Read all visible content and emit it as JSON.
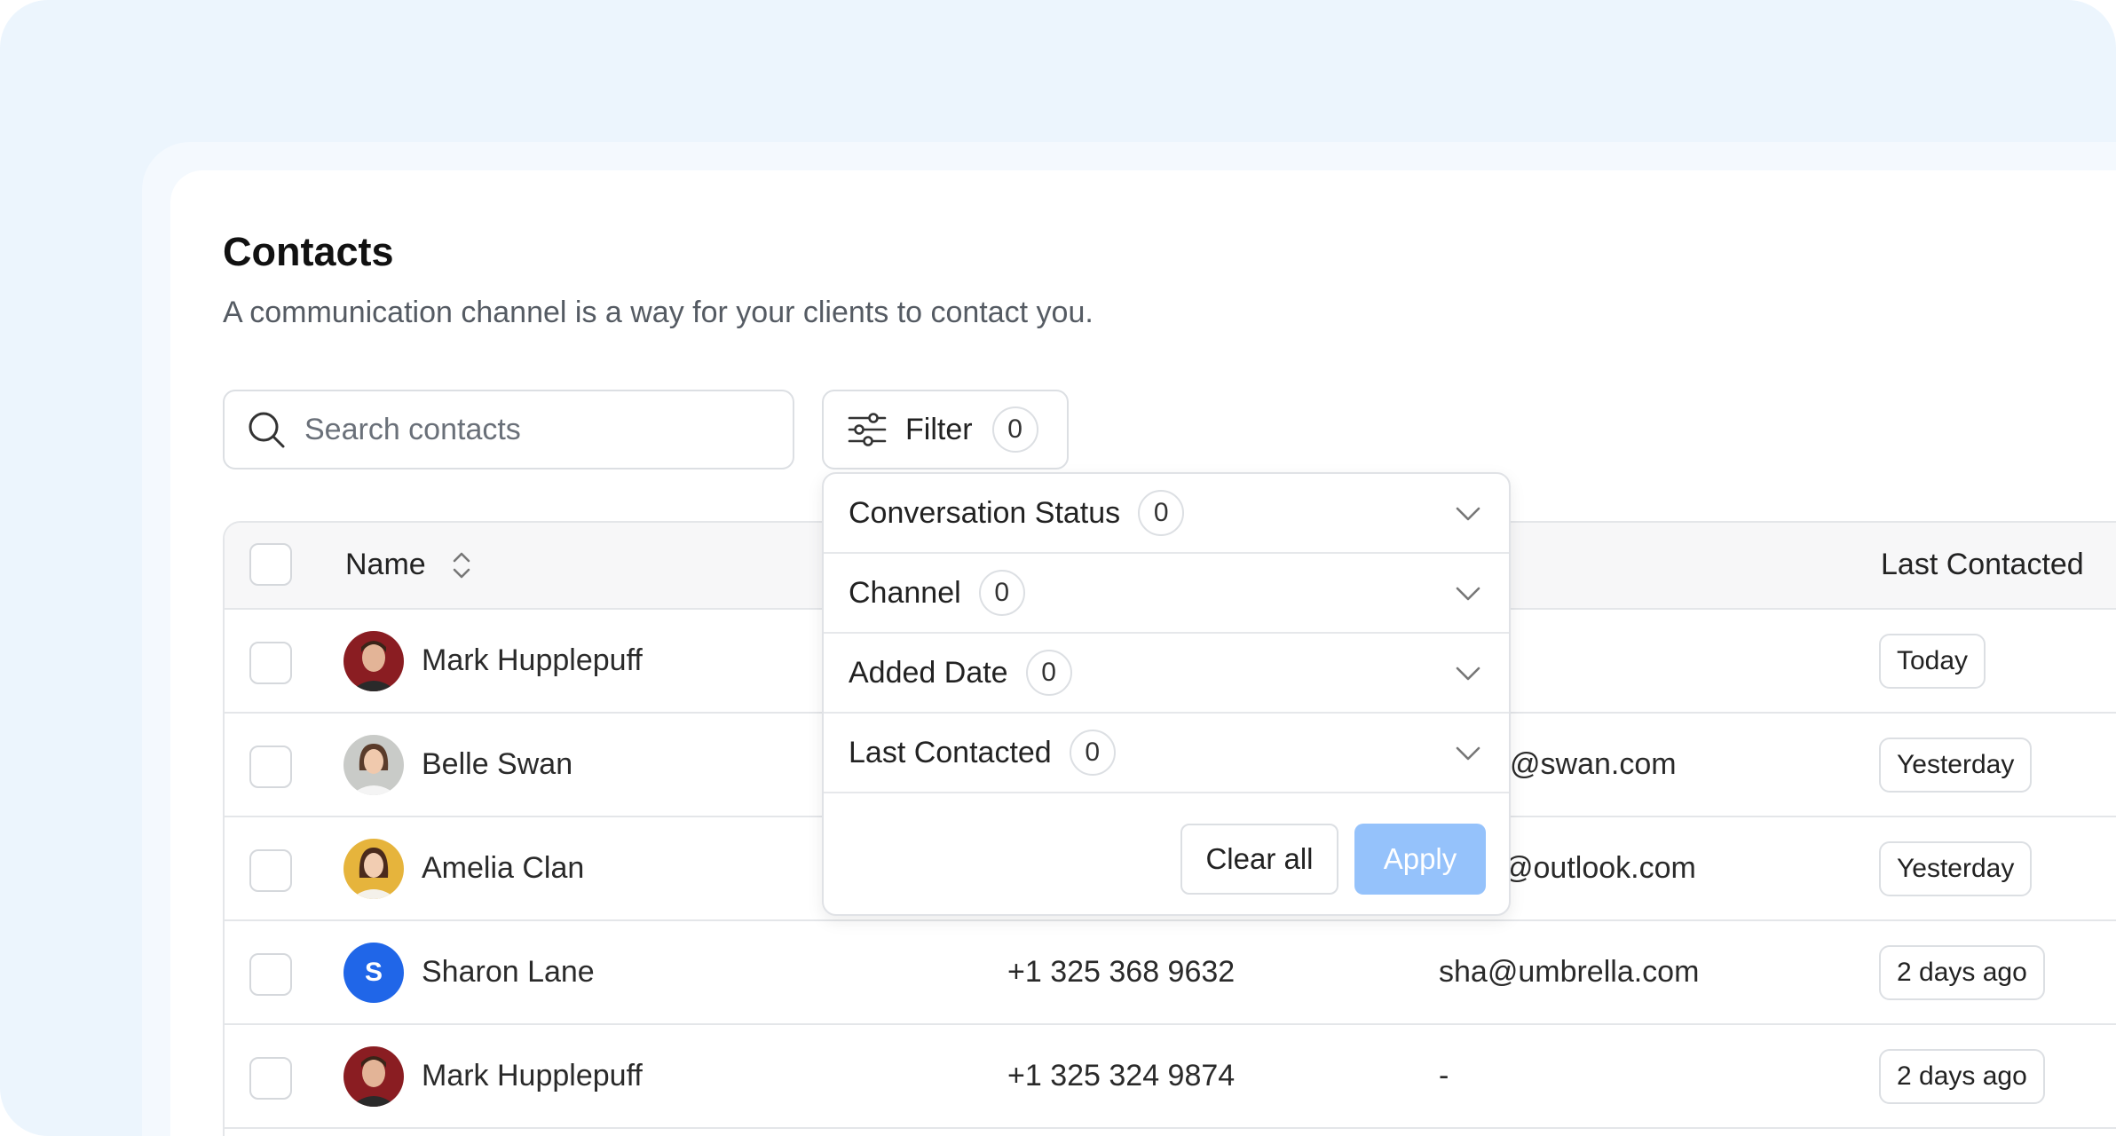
{
  "page": {
    "title": "Contacts",
    "subtitle": "A communication channel is a way for your clients to contact you."
  },
  "search": {
    "placeholder": "Search contacts",
    "icon": "search-icon"
  },
  "filter": {
    "label": "Filter",
    "count": "0",
    "icon": "sliders-icon"
  },
  "table": {
    "headers": {
      "name": "Name",
      "last_contacted": "Last Contacted"
    },
    "rows": [
      {
        "name": "Mark Hupplepuff",
        "phone": "",
        "email": "",
        "last_contacted": "Today",
        "avatar": "photo"
      },
      {
        "name": "Belle Swan",
        "phone": "",
        "email": "@swan.com",
        "last_contacted": "Yesterday",
        "avatar": "photo"
      },
      {
        "name": "Amelia Clan",
        "phone": "",
        "email": "@outlook.com",
        "last_contacted": "Yesterday",
        "avatar": "photo"
      },
      {
        "name": "Sharon Lane",
        "phone": "+1 325 368 9632",
        "email": "sha@umbrella.com",
        "last_contacted": "2 days ago",
        "avatar": "S"
      },
      {
        "name": "Mark Hupplepuff",
        "phone": "+1 325 324 9874",
        "email": "-",
        "last_contacted": "2 days ago",
        "avatar": "photo"
      }
    ]
  },
  "dropdown": {
    "items": [
      {
        "label": "Conversation Status",
        "count": "0"
      },
      {
        "label": "Channel",
        "count": "0"
      },
      {
        "label": "Added Date",
        "count": "0"
      },
      {
        "label": "Last Contacted",
        "count": "0"
      }
    ],
    "clear_label": "Clear all",
    "apply_label": "Apply"
  },
  "colors": {
    "background": "#ecf5fd",
    "accent": "#2066e8",
    "apply_disabled": "#95c2fb"
  }
}
